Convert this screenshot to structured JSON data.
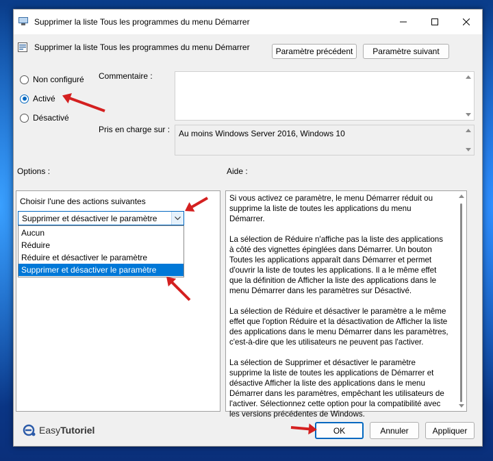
{
  "window": {
    "title": "Supprimer la liste Tous les programmes du menu Démarrer",
    "minimize": "minimize",
    "maximize": "maximize",
    "close": "close"
  },
  "header": {
    "title": "Supprimer la liste Tous les programmes du menu Démarrer",
    "prev_button": "Paramètre précédent",
    "next_button": "Paramètre suivant"
  },
  "state": {
    "options": [
      {
        "label": "Non configuré",
        "selected": false
      },
      {
        "label": "Activé",
        "selected": true
      },
      {
        "label": "Désactivé",
        "selected": false
      }
    ]
  },
  "comment": {
    "label": "Commentaire :",
    "value": ""
  },
  "supported": {
    "label": "Pris en charge sur :",
    "value": "Au moins Windows Server 2016, Windows 10"
  },
  "options_section": {
    "label": "Options :",
    "choose_label": "Choisir l'une des actions suivantes",
    "selected_value": "Supprimer et désactiver le paramètre",
    "items": [
      "Aucun",
      "Réduire",
      "Réduire et désactiver le paramètre",
      "Supprimer et désactiver le paramètre"
    ]
  },
  "help_section": {
    "label": "Aide :",
    "paragraphs": [
      "Si vous activez ce paramètre, le menu Démarrer réduit ou supprime la liste de toutes les applications du menu Démarrer.",
      "La sélection de Réduire n'affiche pas la liste des applications à côté des vignettes épinglées dans Démarrer. Un bouton Toutes les applications apparaît dans Démarrer et permet d'ouvrir la liste de toutes les applications. Il a le même effet que la définition de Afficher la liste des applications dans le menu Démarrer dans les paramètres sur Désactivé.",
      "La sélection de Réduire et désactiver le paramètre a le même effet que l'option Réduire et la désactivation de Afficher la liste des applications dans le menu Démarrer dans les paramètres, c'est-à-dire que les utilisateurs ne peuvent pas l'activer.",
      "La sélection de Supprimer et désactiver le paramètre supprime la liste de toutes les applications de Démarrer et désactive Afficher la liste des applications dans le menu Démarrer dans les paramètres, empêchant les utilisateurs de l'activer. Sélectionnez cette option pour la compatibilité avec les versions précédentes de Windows."
    ]
  },
  "footer": {
    "logo_easy": "Easy",
    "logo_tutoriel": "Tutoriel",
    "ok": "OK",
    "cancel": "Annuler",
    "apply": "Appliquer"
  },
  "colors": {
    "accent": "#0067c0",
    "selection": "#0078d7",
    "annotation_arrow": "#d42020"
  }
}
